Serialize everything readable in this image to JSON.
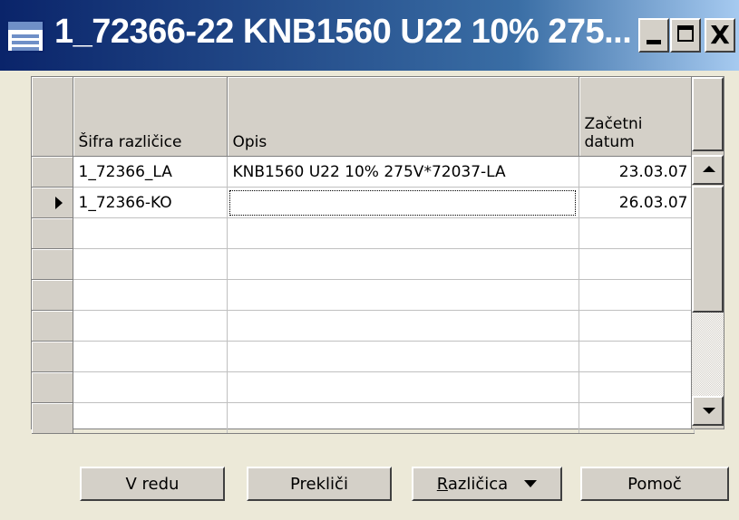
{
  "window": {
    "title": "1_72366-22 KNB1560 U22 10% 275...",
    "minimize_icon": "minimize-icon",
    "maximize_icon": "maximize-icon",
    "close_icon": "close-icon",
    "close_glyph": "X"
  },
  "table": {
    "columns": [
      "Šifra različice",
      "Opis",
      "Začetni datum"
    ],
    "rows": [
      {
        "code": "1_72366_LA",
        "description": "KNB1560 U22 10% 275V*72037-LA",
        "start_date": "23.03.07",
        "current": false
      },
      {
        "code": "1_72366-KO",
        "description": "",
        "start_date": "26.03.07",
        "current": true
      },
      {
        "code": "",
        "description": "",
        "start_date": "",
        "current": false
      },
      {
        "code": "",
        "description": "",
        "start_date": "",
        "current": false
      },
      {
        "code": "",
        "description": "",
        "start_date": "",
        "current": false
      },
      {
        "code": "",
        "description": "",
        "start_date": "",
        "current": false
      },
      {
        "code": "",
        "description": "",
        "start_date": "",
        "current": false
      },
      {
        "code": "",
        "description": "",
        "start_date": "",
        "current": false
      },
      {
        "code": "",
        "description": "",
        "start_date": "",
        "current": false
      }
    ]
  },
  "buttons": {
    "ok": "V redu",
    "cancel": "Prekliči",
    "variant_accel": "R",
    "variant_rest": "azličica",
    "help": "Pomoč"
  },
  "colors": {
    "title_bar_start": "#0a246a",
    "title_bar_end": "#a6caf0",
    "face": "#d4d0c8",
    "background": "#ece9d8"
  }
}
